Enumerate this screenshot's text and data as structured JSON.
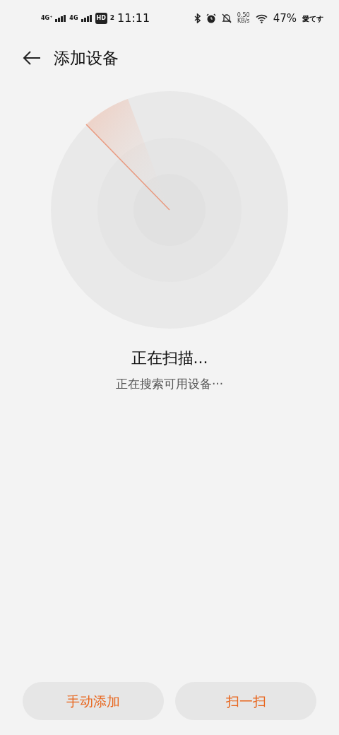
{
  "status_bar": {
    "signal_1": "4G⁺",
    "signal_2": "4G",
    "hd": "HD",
    "hd_sub": "2",
    "time": "11:11",
    "speed_value": "0.50",
    "speed_unit": "KB/s",
    "battery": "47%",
    "carrier": "愛てす"
  },
  "header": {
    "title": "添加设备"
  },
  "scan": {
    "title": "正在扫描...",
    "subtitle": "正在搜索可用设备···"
  },
  "buttons": [
    {
      "label": "手动添加"
    },
    {
      "label": "扫一扫"
    }
  ]
}
